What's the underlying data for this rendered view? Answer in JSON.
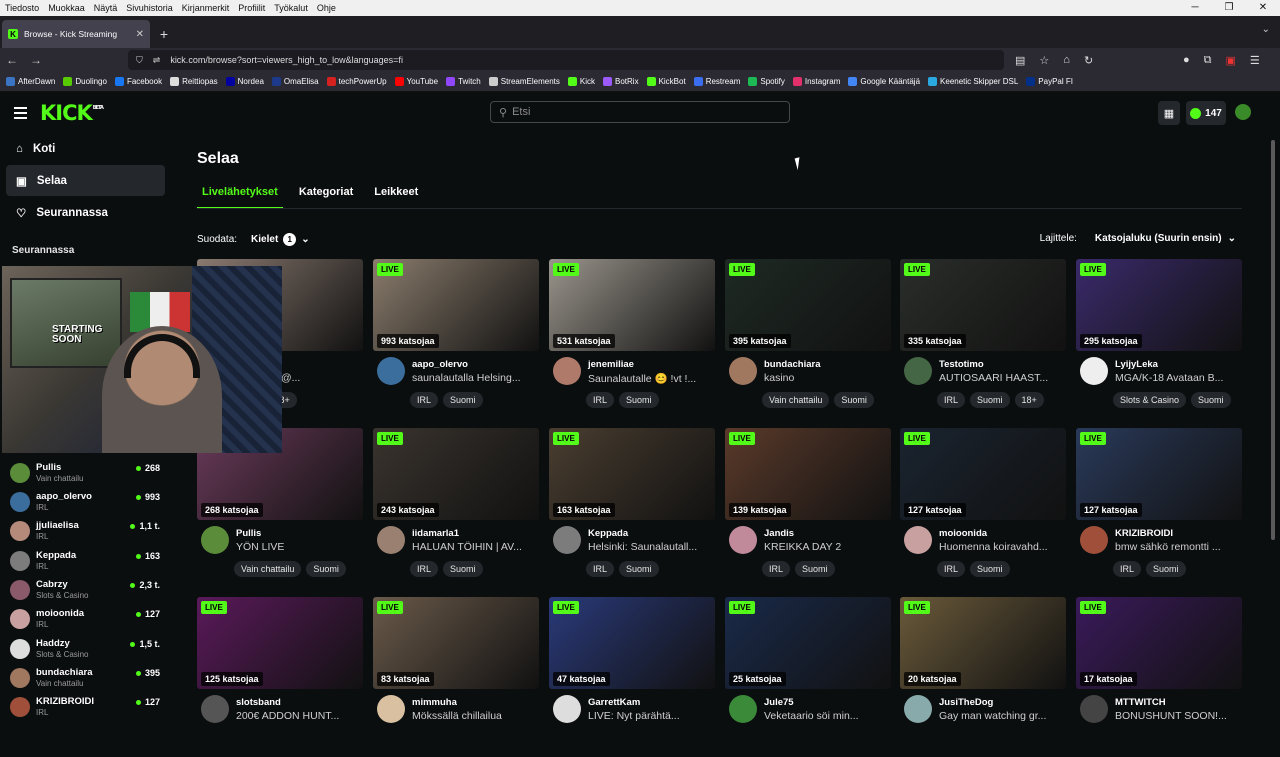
{
  "os_menu": [
    "Tiedosto",
    "Muokkaa",
    "Näytä",
    "Sivuhistoria",
    "Kirjanmerkit",
    "Profiilit",
    "Työkalut",
    "Ohje"
  ],
  "browser": {
    "tab_title": "Browse - Kick Streaming",
    "url": "kick.com/browse?sort=viewers_high_to_low&languages=fi"
  },
  "bookmarks": [
    {
      "label": "AfterDawn",
      "color": "#3c74c4"
    },
    {
      "label": "Duolingo",
      "color": "#58cc02"
    },
    {
      "label": "Facebook",
      "color": "#1877f2"
    },
    {
      "label": "Reittiopas",
      "color": "#dddddd"
    },
    {
      "label": "Nordea",
      "color": "#0000a0"
    },
    {
      "label": "OmaElisa",
      "color": "#1d3a8a"
    },
    {
      "label": "techPowerUp",
      "color": "#d62121"
    },
    {
      "label": "YouTube",
      "color": "#ff0000"
    },
    {
      "label": "Twitch",
      "color": "#9146ff"
    },
    {
      "label": "StreamElements",
      "color": "#cccccc"
    },
    {
      "label": "Kick",
      "color": "#53fc18"
    },
    {
      "label": "BotRix",
      "color": "#9b59ff"
    },
    {
      "label": "KickBot",
      "color": "#53fc18"
    },
    {
      "label": "Restream",
      "color": "#3a6df0"
    },
    {
      "label": "Spotify",
      "color": "#1db954"
    },
    {
      "label": "Instagram",
      "color": "#e1306c"
    },
    {
      "label": "Google Kääntäjä",
      "color": "#4285f4"
    },
    {
      "label": "Keenetic Skipper DSL",
      "color": "#2aa8e0"
    },
    {
      "label": "PayPal FI",
      "color": "#003087"
    }
  ],
  "header": {
    "logo": "KICK",
    "beta": "BETA",
    "search_placeholder": "Etsi",
    "points": "147"
  },
  "sidebar": {
    "nav": [
      "Koti",
      "Selaa",
      "Seurannassa"
    ],
    "following_heading": "Seurannassa",
    "following": [
      {
        "name": "Pullis",
        "category": "Vain chattailu",
        "viewers": "268",
        "color": "#5b8c3a"
      },
      {
        "name": "aapo_olervo",
        "category": "IRL",
        "viewers": "993",
        "color": "#3b6e9c"
      },
      {
        "name": "jjuliaelisa",
        "category": "IRL",
        "viewers": "1,1 t.",
        "color": "#b58a7a"
      },
      {
        "name": "Keppada",
        "category": "IRL",
        "viewers": "163",
        "color": "#7c7c7c"
      },
      {
        "name": "Cabrzy",
        "category": "Slots & Casino",
        "viewers": "2,3 t.",
        "color": "#8a5a6a"
      },
      {
        "name": "moioonida",
        "category": "IRL",
        "viewers": "127",
        "color": "#c9a0a0"
      },
      {
        "name": "Haddzy",
        "category": "Slots & Casino",
        "viewers": "1,5 t.",
        "color": "#dddddd"
      },
      {
        "name": "bundachiara",
        "category": "Vain chattailu",
        "viewers": "395",
        "color": "#a07860"
      },
      {
        "name": "KRIZIBROIDI",
        "category": "IRL",
        "viewers": "127",
        "color": "#a0503a"
      }
    ]
  },
  "main": {
    "title": "Selaa",
    "tabs": [
      "Livelähetykset",
      "Kategoriat",
      "Leikkeet"
    ],
    "filter_label": "Suodata:",
    "filter_button": "Kielet",
    "filter_count": "1",
    "sort_label": "Lajittele:",
    "sort_value": "Katsojaluku (Suurin ensin)",
    "live_label": "LIVE",
    "streams": [
      {
        "name": "",
        "title": "valla feat @...",
        "viewers": "",
        "tags": [
          "omi",
          "18+"
        ],
        "thumb": "#8a7a70",
        "avatar": "#888"
      },
      {
        "name": "aapo_olervo",
        "title": "saunalautalla Helsing...",
        "viewers": "993 katsojaa",
        "tags": [
          "IRL",
          "Suomi"
        ],
        "thumb": "#8a7c6c",
        "avatar": "#3b6e9c"
      },
      {
        "name": "jenemiliae",
        "title": "Saunalautalle 😊 !vt !...",
        "viewers": "531 katsojaa",
        "tags": [
          "IRL",
          "Suomi"
        ],
        "thumb": "#9a958c",
        "avatar": "#b07a6a"
      },
      {
        "name": "bundachiara",
        "title": "kasino",
        "viewers": "395 katsojaa",
        "tags": [
          "Vain chattailu",
          "Suomi"
        ],
        "thumb": "#1e2a24",
        "avatar": "#a07860"
      },
      {
        "name": "Testotimo",
        "title": "AUTIOSAARI HAAST...",
        "viewers": "335 katsojaa",
        "tags": [
          "IRL",
          "Suomi",
          "18+"
        ],
        "thumb": "#2a2e2a",
        "avatar": "#446644"
      },
      {
        "name": "LyijyLeka",
        "title": "MGA/K-18 Avataan B...",
        "viewers": "295 katsojaa",
        "tags": [
          "Slots & Casino",
          "Suomi"
        ],
        "thumb": "#3a2a6a",
        "avatar": "#eeeeee"
      },
      {
        "name": "Pullis",
        "title": "YÖN LIVE",
        "viewers": "268 katsojaa",
        "tags": [
          "Vain chattailu",
          "Suomi"
        ],
        "thumb": "#6a3a5a",
        "avatar": "#5b8c3a"
      },
      {
        "name": "iidamarla1",
        "title": "HALUAN TÖIHIN | AV...",
        "viewers": "243 katsojaa",
        "tags": [
          "IRL",
          "Suomi"
        ],
        "thumb": "#3a342e",
        "avatar": "#9a8070"
      },
      {
        "name": "Keppada",
        "title": "Helsinki: Saunalautall...",
        "viewers": "163 katsojaa",
        "tags": [
          "IRL",
          "Suomi"
        ],
        "thumb": "#4a3e30",
        "avatar": "#7c7c7c"
      },
      {
        "name": "Jandis",
        "title": "KREIKKA DAY 2",
        "viewers": "139 katsojaa",
        "tags": [
          "IRL",
          "Suomi"
        ],
        "thumb": "#5a3a2a",
        "avatar": "#c08a9a"
      },
      {
        "name": "moioonida",
        "title": "Huomenna koiravahd...",
        "viewers": "127 katsojaa",
        "tags": [
          "IRL",
          "Suomi"
        ],
        "thumb": "#1a2430",
        "avatar": "#c9a0a0"
      },
      {
        "name": "KRIZIBROIDI",
        "title": "bmw sähkö remontti ...",
        "viewers": "127 katsojaa",
        "tags": [
          "IRL",
          "Suomi"
        ],
        "thumb": "#2a3a5a",
        "avatar": "#a0503a"
      },
      {
        "name": "slotsband",
        "title": "200€ ADDON HUNT...",
        "viewers": "125 katsojaa",
        "tags": [],
        "thumb": "#5a1a5a",
        "avatar": "#555"
      },
      {
        "name": "mimmuha",
        "title": "Mökssällä chillailua",
        "viewers": "83 katsojaa",
        "tags": [],
        "thumb": "#6a5a4a",
        "avatar": "#d8c0a0"
      },
      {
        "name": "GarrettKam",
        "title": "LIVE: Nyt pärähtä...",
        "viewers": "47 katsojaa",
        "tags": [],
        "thumb": "#2a3a7a",
        "avatar": "#ddd"
      },
      {
        "name": "Jule75",
        "title": "Veketaario söi min...",
        "viewers": "25 katsojaa",
        "tags": [],
        "thumb": "#1a2a4a",
        "avatar": "#3a8a3a"
      },
      {
        "name": "JusiTheDog",
        "title": "Gay man watching gr...",
        "viewers": "20 katsojaa",
        "tags": [],
        "thumb": "#6a5a3a",
        "avatar": "#8aa"
      },
      {
        "name": "MTTWITCH",
        "title": "BONUSHUNT SOON!...",
        "viewers": "17 katsojaa",
        "tags": [],
        "thumb": "#3a1a5a",
        "avatar": "#444"
      }
    ]
  },
  "webcam_overlay": {
    "text": "STARTING SOON"
  }
}
